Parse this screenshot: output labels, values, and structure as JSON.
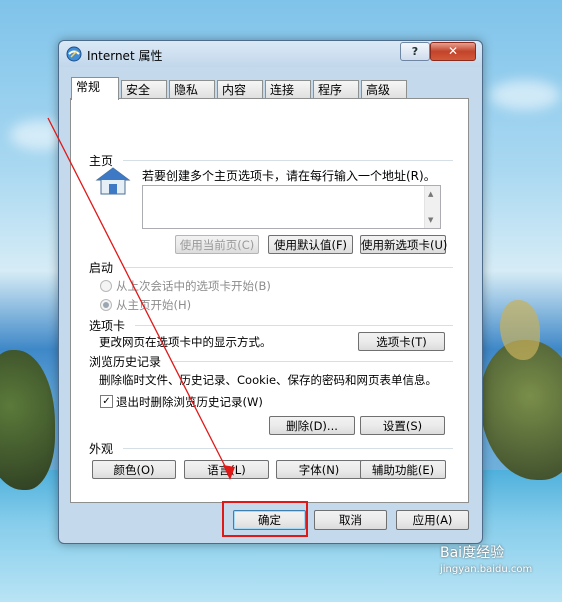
{
  "window": {
    "title": "Internet 属性",
    "help_label": "?",
    "close_label": "✕"
  },
  "tabs": [
    "常规",
    "安全",
    "隐私",
    "内容",
    "连接",
    "程序",
    "高级"
  ],
  "home": {
    "group_label": "主页",
    "description": "若要创建多个主页选项卡，请在每行输入一个地址(R)。",
    "address_value": "",
    "buttons": [
      "使用当前页(C)",
      "使用默认值(F)",
      "使用新选项卡(U)"
    ]
  },
  "startup": {
    "group_label": "启动",
    "options": [
      "从上次会话中的选项卡开始(B)",
      "从主页开始(H)"
    ]
  },
  "tabs_group": {
    "group_label": "选项卡",
    "description": "更改网页在选项卡中的显示方式。",
    "button": "选项卡(T)"
  },
  "history": {
    "group_label": "浏览历史记录",
    "description": "删除临时文件、历史记录、Cookie、保存的密码和网页表单信息。",
    "checkbox_label": "退出时删除浏览历史记录(W)",
    "checkbox_mark": "✓",
    "buttons": [
      "删除(D)...",
      "设置(S)"
    ]
  },
  "appearance": {
    "group_label": "外观",
    "buttons": [
      "颜色(O)",
      "语言(L)",
      "字体(N)",
      "辅助功能(E)"
    ]
  },
  "footer": {
    "ok": "确定",
    "cancel": "取消",
    "apply": "应用(A)"
  },
  "watermark": {
    "logo": "Bai度经验",
    "url": "jingyan.baidu.com"
  },
  "colors": {
    "annotation": "#e11818",
    "titlebar": "#c4d9ec"
  }
}
